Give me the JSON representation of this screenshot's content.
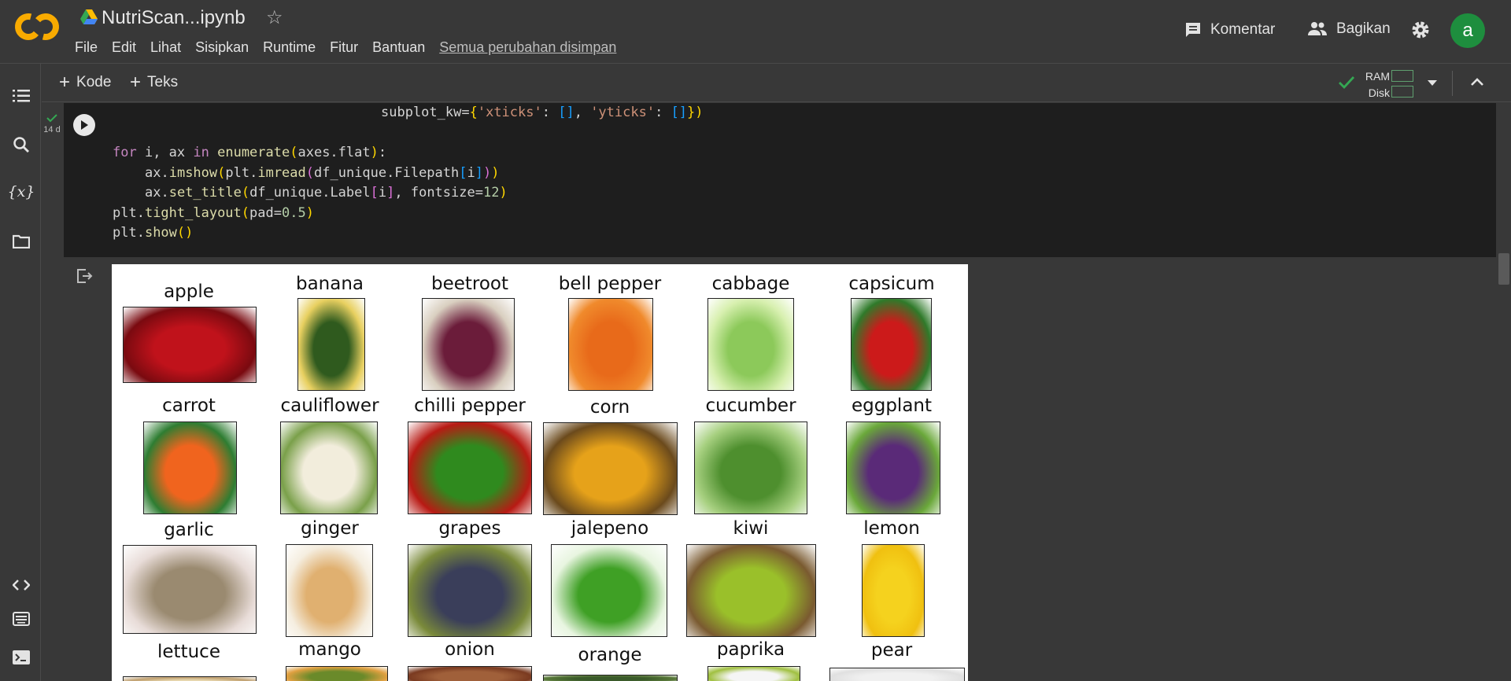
{
  "header": {
    "title": "NutriScan...ipynb",
    "menu": [
      "File",
      "Edit",
      "Lihat",
      "Sisipkan",
      "Runtime",
      "Fitur",
      "Bantuan"
    ],
    "save_status": "Semua perubahan disimpan",
    "comment_label": "Komentar",
    "share_label": "Bagikan",
    "avatar_letter": "a"
  },
  "toolbar": {
    "add_code": "Kode",
    "add_text": "Teks",
    "ram_label": "RAM",
    "disk_label": "Disk"
  },
  "cell": {
    "exec_status": "14 d"
  },
  "output": {
    "labels": [
      "apple",
      "banana",
      "beetroot",
      "bell pepper",
      "cabbage",
      "capsicum",
      "carrot",
      "cauliflower",
      "chilli pepper",
      "corn",
      "cucumber",
      "eggplant",
      "garlic",
      "ginger",
      "grapes",
      "jalepeno",
      "kiwi",
      "lemon",
      "lettuce",
      "mango",
      "onion",
      "orange",
      "paprika",
      "pear"
    ]
  },
  "colors": {
    "background": "#383838",
    "code_background": "#1e1e1e",
    "avatar": "#1e8e3e",
    "check": "#34a853"
  }
}
